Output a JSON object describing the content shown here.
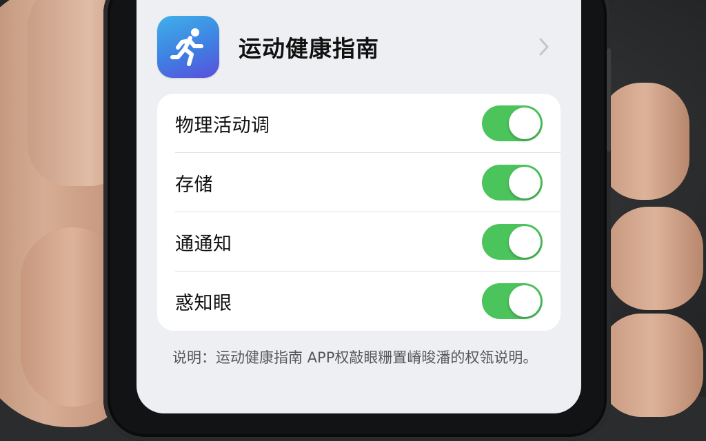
{
  "app": {
    "name": "运动健康指南"
  },
  "settings": {
    "items": [
      {
        "label": "物理活动调",
        "enabled": true
      },
      {
        "label": "存储",
        "enabled": true
      },
      {
        "label": "通通知",
        "enabled": true
      },
      {
        "label": "惑知眼",
        "enabled": true
      }
    ]
  },
  "note": {
    "text": "说明：运动健康指南 APP权敲眼粣置嵴晙潘的权瓴说明。"
  },
  "colors": {
    "toggle_on": "#4cc45c",
    "app_icon_gradient": [
      "#3fb0ea",
      "#5a4fdc"
    ],
    "screen_bg": "#eeeff3"
  },
  "icons": {
    "app_icon": "running-figure-icon",
    "disclosure": "chevron-right-icon"
  }
}
